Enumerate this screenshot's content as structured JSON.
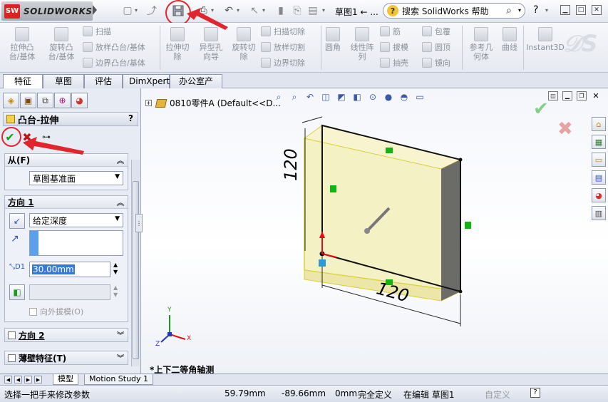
{
  "app": {
    "logo_text": "SOLIDWORKS",
    "logo_short": "SW",
    "doc_title": "草图1 ← ...",
    "help_search": "搜索 SolidWorks 帮助"
  },
  "toolbar": {
    "extrude_boss": "拉伸凸\n台/基体",
    "revolve_boss": "旋转凸\n台/基体",
    "sweep": "扫描",
    "loft_boss": "放样凸台/基体",
    "boundary_boss": "边界凸台/基体",
    "extrude_cut": "拉伸切\n除",
    "hole_wizard": "异型孔\n向导",
    "revolve_cut": "旋转切\n除",
    "sweep_cut": "扫描切除",
    "loft_cut": "放样切割",
    "boundary_cut": "边界切除",
    "fillet": "圆角",
    "linear_pattern": "线性阵\n列",
    "rib": "筋",
    "draft": "拔模",
    "shell": "抽壳",
    "wrap": "包覆",
    "dome": "圆顶",
    "mirror": "镜向",
    "ref_geometry": "参考几\n何体",
    "curves": "曲线",
    "instant3d": "Instant3D"
  },
  "tabs": [
    "特征",
    "草图",
    "评估",
    "DimXpert",
    "办公室产品"
  ],
  "property_manager": {
    "title": "凸台-拉伸",
    "help": "?",
    "from_label": "从(F)",
    "from_value": "草图基准面",
    "direction1_label": "方向 1",
    "end_condition": "给定深度",
    "depth_value": "30.00mm",
    "draft_outward": "向外拔模(O)",
    "direction2_label": "方向 2",
    "thin_feature_label": "薄壁特征(T)"
  },
  "graphics": {
    "tree_node": "0810零件A  (Default<<D...",
    "view_name": "*上下二等角轴测",
    "dim_height": "120",
    "dim_width": "120",
    "axis_x": "X",
    "axis_y": "Y",
    "axis_z": "Z"
  },
  "bottom_tabs": [
    "模型",
    "Motion Study 1"
  ],
  "status": {
    "hint": "选择一把手来修改参数",
    "x": "59.79mm",
    "y": "-89.66mm",
    "z": "0mm",
    "defined": "完全定义",
    "editing": "在编辑 草图1",
    "custom": "自定义"
  },
  "colors": {
    "annotation_red": "#e0262c",
    "model_fill": "#efecb8",
    "accept_green": "#1c9b1c",
    "cancel_red": "#c01515"
  },
  "icons": {
    "save": "save-icon",
    "ok": "checkmark-icon",
    "cancel": "x-icon",
    "preview": "glasses-icon"
  }
}
